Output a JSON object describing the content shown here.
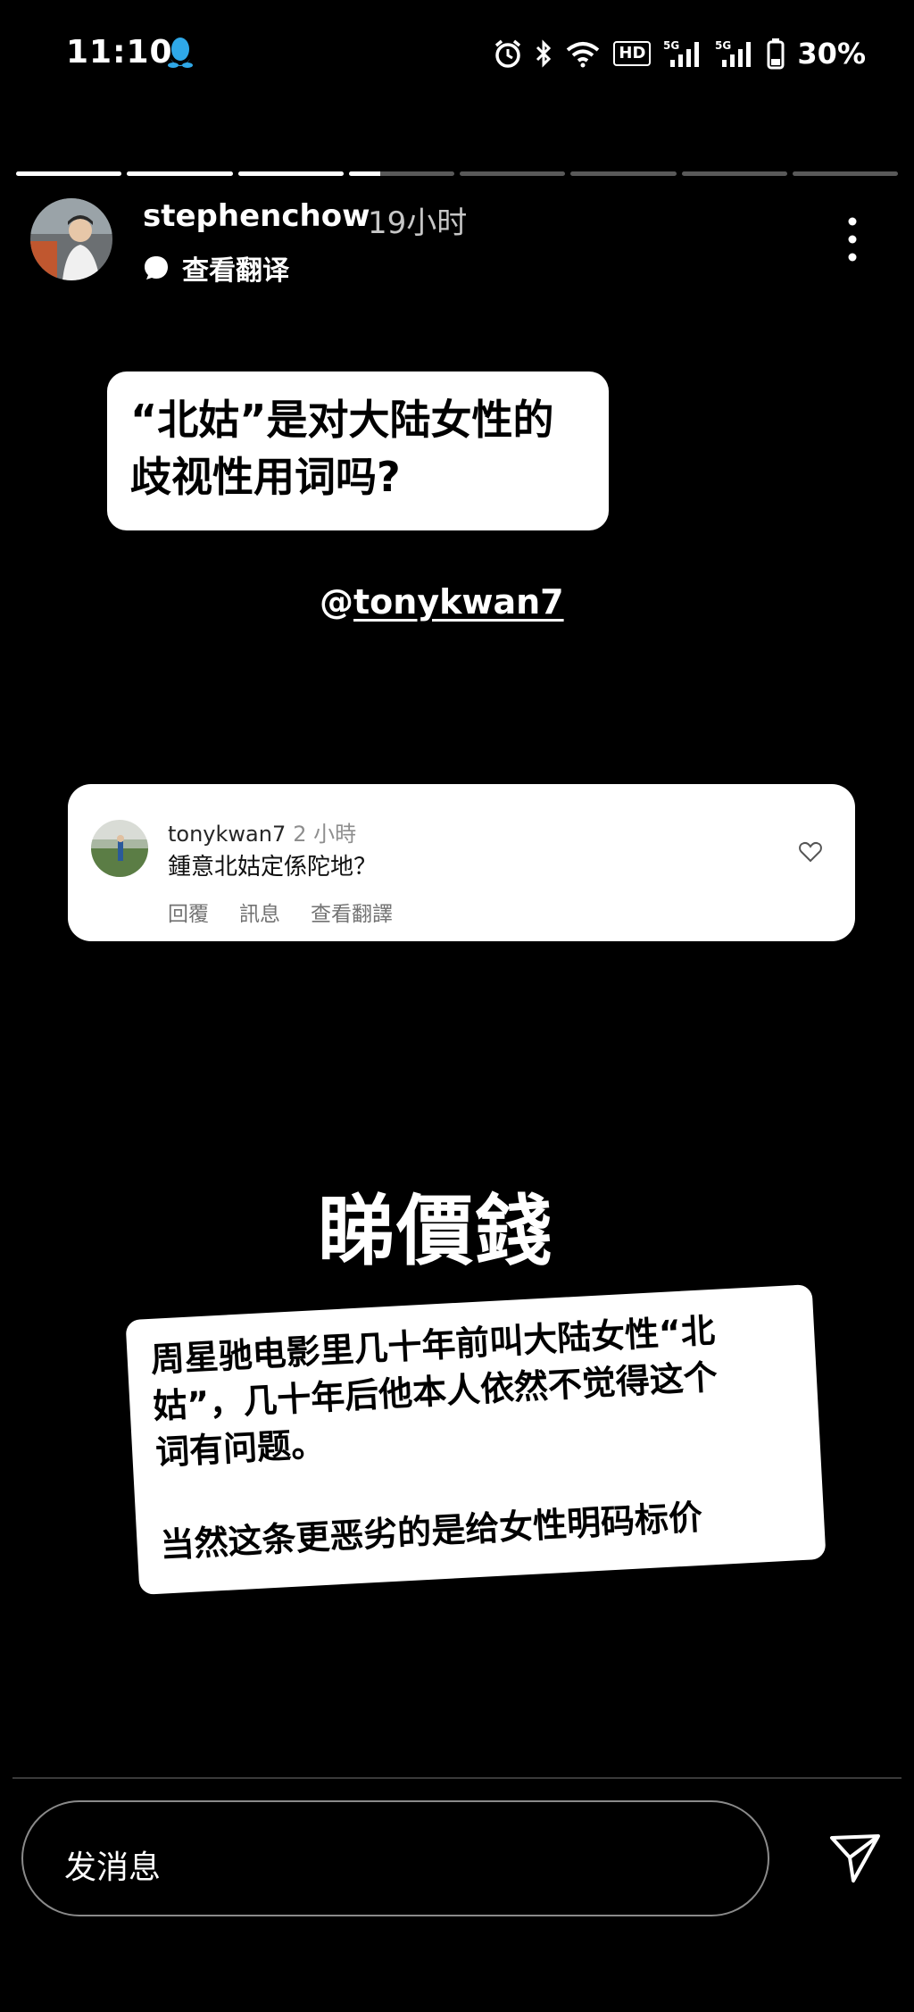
{
  "status_bar": {
    "time": "11:10",
    "hd_label": "HD",
    "battery": "30%",
    "icons": [
      "qq-icon",
      "alarm-icon",
      "bluetooth-icon",
      "wifi-icon",
      "hd-icon",
      "signal-5g-icon",
      "signal-5g-icon",
      "battery-icon"
    ]
  },
  "story": {
    "progress": {
      "segments": 8,
      "current_index": 3,
      "current_fraction": 0.3
    },
    "header": {
      "username": "stephenchow",
      "time_ago": "19小时",
      "translate_label": "查看翻译"
    },
    "question_card": {
      "line1": "“北姑”是对大陆女性的",
      "line2": "歧视性用词吗?"
    },
    "mention": {
      "at": "@",
      "handle": "tonykwan7"
    },
    "comment": {
      "username": "tonykwan7",
      "time": "2 小時",
      "text": "鍾意北姑定係陀地？",
      "actions": {
        "reply": "回覆",
        "message": "訊息",
        "translate": "查看翻譯"
      }
    },
    "big_text": "睇價錢",
    "note": {
      "line1": "周星驰电影里几十年前叫大陆女性“北",
      "line2": "姑”，几十年后他本人依然不觉得这个",
      "line3": "词有问题。",
      "line4": "当然这条更恶劣的是给女性明码标价"
    }
  },
  "footer": {
    "message_placeholder": "发消息"
  },
  "colors": {
    "background": "#000000",
    "card": "#ffffff",
    "muted_text": "#8e8e8e"
  }
}
